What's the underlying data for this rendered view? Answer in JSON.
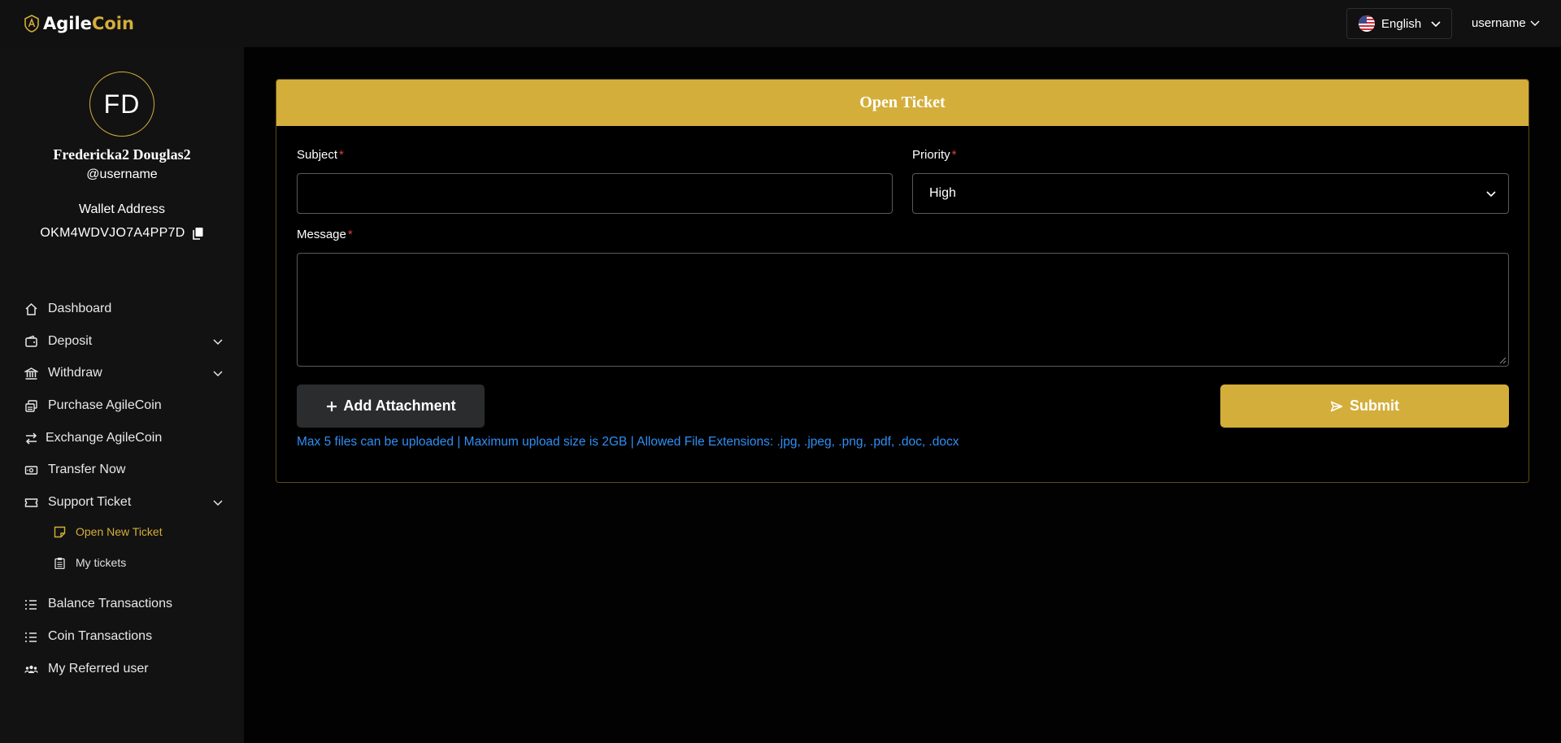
{
  "brand": {
    "part1": "Agile",
    "part2": "Coin",
    "accent": "#d4ae3a"
  },
  "topbar": {
    "language": {
      "label": "English",
      "flag_icon": "us-flag-icon"
    },
    "user_menu": {
      "label": "username"
    }
  },
  "profile": {
    "initials": "FD",
    "name": "Fredericka2 Douglas2",
    "username": "@username",
    "wallet_label": "Wallet Address",
    "wallet_address": "OKM4WDVJO7A4PP7D"
  },
  "sidebar": {
    "items": [
      {
        "label": "Dashboard",
        "icon": "home-icon"
      },
      {
        "label": "Deposit",
        "icon": "wallet-icon",
        "expandable": true
      },
      {
        "label": "Withdraw",
        "icon": "bank-icon",
        "expandable": true
      },
      {
        "label": "Purchase AgileCoin",
        "icon": "coins-icon"
      },
      {
        "label": "Exchange AgileCoin",
        "icon": "exchange-icon"
      },
      {
        "label": "Transfer Now",
        "icon": "money-icon"
      },
      {
        "label": "Support Ticket",
        "icon": "ticket-icon",
        "expandable": true
      },
      {
        "label": "Balance Transactions",
        "icon": "list-icon"
      },
      {
        "label": "Coin Transactions",
        "icon": "list-icon"
      },
      {
        "label": "My Referred user",
        "icon": "users-icon"
      }
    ],
    "support_sub": [
      {
        "label": "Open New Ticket",
        "icon": "note-icon",
        "active": true
      },
      {
        "label": "My tickets",
        "icon": "clipboard-icon",
        "active": false
      }
    ]
  },
  "ticket_form": {
    "title": "Open Ticket",
    "subject": {
      "label": "Subject",
      "value": "",
      "required": "*"
    },
    "priority": {
      "label": "Priority",
      "value": "High",
      "required": "*"
    },
    "message": {
      "label": "Message",
      "value": "",
      "required": "*"
    },
    "add_attachment_label": "Add Attachment",
    "submit_label": "Submit",
    "upload_note": "Max 5 files can be uploaded | Maximum upload size is 2GB | Allowed File Extensions: .jpg, .jpeg, .png, .pdf, .doc, .docx"
  }
}
